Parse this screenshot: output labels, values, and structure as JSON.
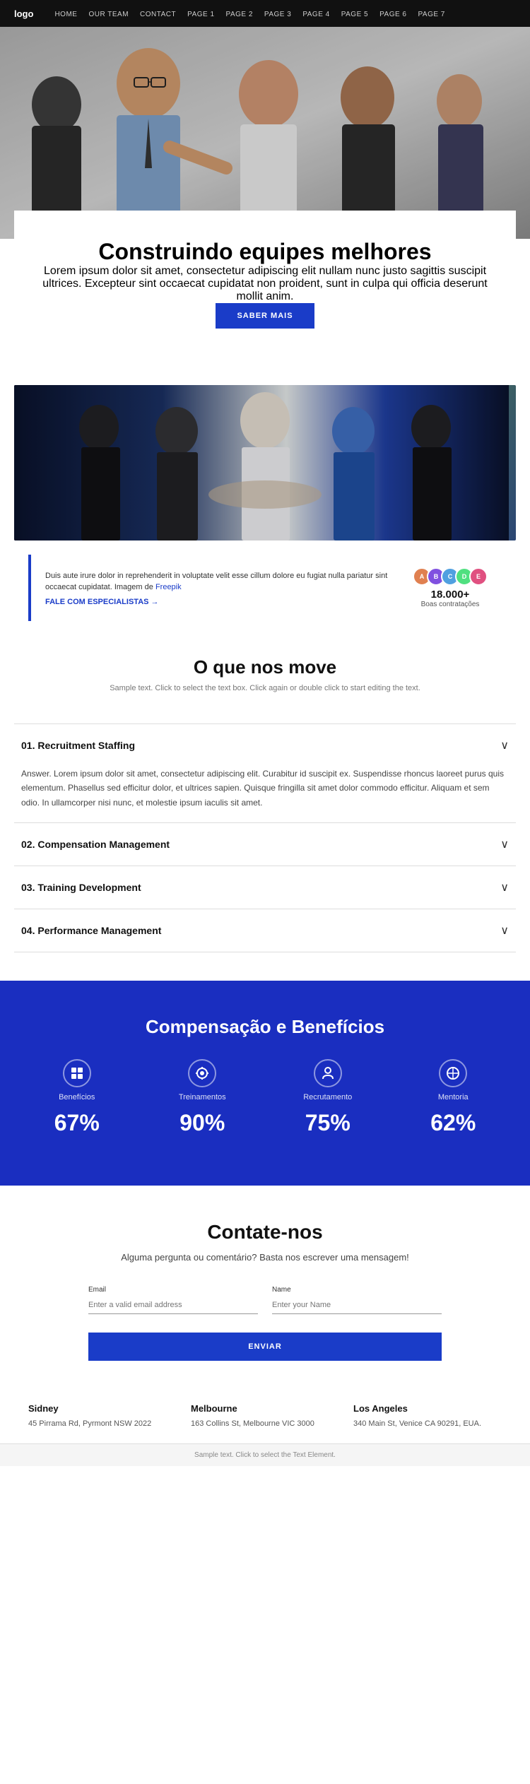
{
  "nav": {
    "logo": "logo",
    "links": [
      "HOME",
      "OUR TEAM",
      "CONTACT",
      "PAGE 1",
      "PAGE 2",
      "PAGE 3",
      "PAGE 4",
      "PAGE 5",
      "PAGE 6",
      "PAGE 7"
    ]
  },
  "hero": {
    "card": {
      "title": "Construindo equipes melhores",
      "description": "Lorem ipsum dolor sit amet, consectetur adipiscing elit nullam nunc justo sagittis suscipit ultrices. Excepteur sint occaecat cupidatat non proident, sunt in culpa qui officia deserunt mollit anim.",
      "button": "SABER MAIS"
    }
  },
  "stats": {
    "text": "Duis aute irure dolor in reprehenderit in voluptate velit esse cillum dolore eu fugiat nulla pariatur sint occaecat cupidatat. Imagem de ",
    "freepik_label": "Freepik",
    "cta": "FALE COM ESPECIALISTAS →",
    "count": "18.000+",
    "label": "Boas contratações"
  },
  "section_what": {
    "title": "O que nos move",
    "subtitle": "Sample text. Click to select the text box. Click again or double click to start editing the text."
  },
  "accordion": [
    {
      "id": "acc-1",
      "number": "01.",
      "title": "Recruitment Staffing",
      "open": true,
      "body": "Answer. Lorem ipsum dolor sit amet, consectetur adipiscing elit. Curabitur id suscipit ex. Suspendisse rhoncus laoreet purus quis elementum. Phasellus sed efficitur dolor, et ultrices sapien. Quisque fringilla sit amet dolor commodo efficitur. Aliquam et sem odio. In ullamcorper nisi nunc, et molestie ipsum iaculis sit amet."
    },
    {
      "id": "acc-2",
      "number": "02.",
      "title": "Compensation Management",
      "open": false,
      "body": ""
    },
    {
      "id": "acc-3",
      "number": "03.",
      "title": "Training Development",
      "open": false,
      "body": ""
    },
    {
      "id": "acc-4",
      "number": "04.",
      "title": "Performance Management",
      "open": false,
      "body": ""
    }
  ],
  "blue_section": {
    "title": "Compensação e Benefícios",
    "items": [
      {
        "icon": "⊞",
        "label": "Benefícios",
        "percent": "67%"
      },
      {
        "icon": "⚙",
        "label": "Treinamentos",
        "percent": "90%"
      },
      {
        "icon": "👤",
        "label": "Recrutamento",
        "percent": "75%"
      },
      {
        "icon": "⊕",
        "label": "Mentoria",
        "percent": "62%"
      }
    ]
  },
  "contact": {
    "title": "Contate-nos",
    "subtitle": "Alguma pergunta ou comentário? Basta nos escrever uma mensagem!",
    "email_label": "Email",
    "email_placeholder": "Enter a valid email address",
    "name_label": "Name",
    "name_placeholder": "Enter your Name",
    "button": "ENVIAR"
  },
  "offices": [
    {
      "city": "Sidney",
      "address": "45 Pirrama Rd, Pyrmont NSW 2022"
    },
    {
      "city": "Melbourne",
      "address": "163 Collins St, Melbourne VIC 3000"
    },
    {
      "city": "Los Angeles",
      "address": "340 Main St, Venice CA 90291, EUA."
    }
  ],
  "footer": {
    "note": "Sample text. Click to select the Text Element."
  }
}
